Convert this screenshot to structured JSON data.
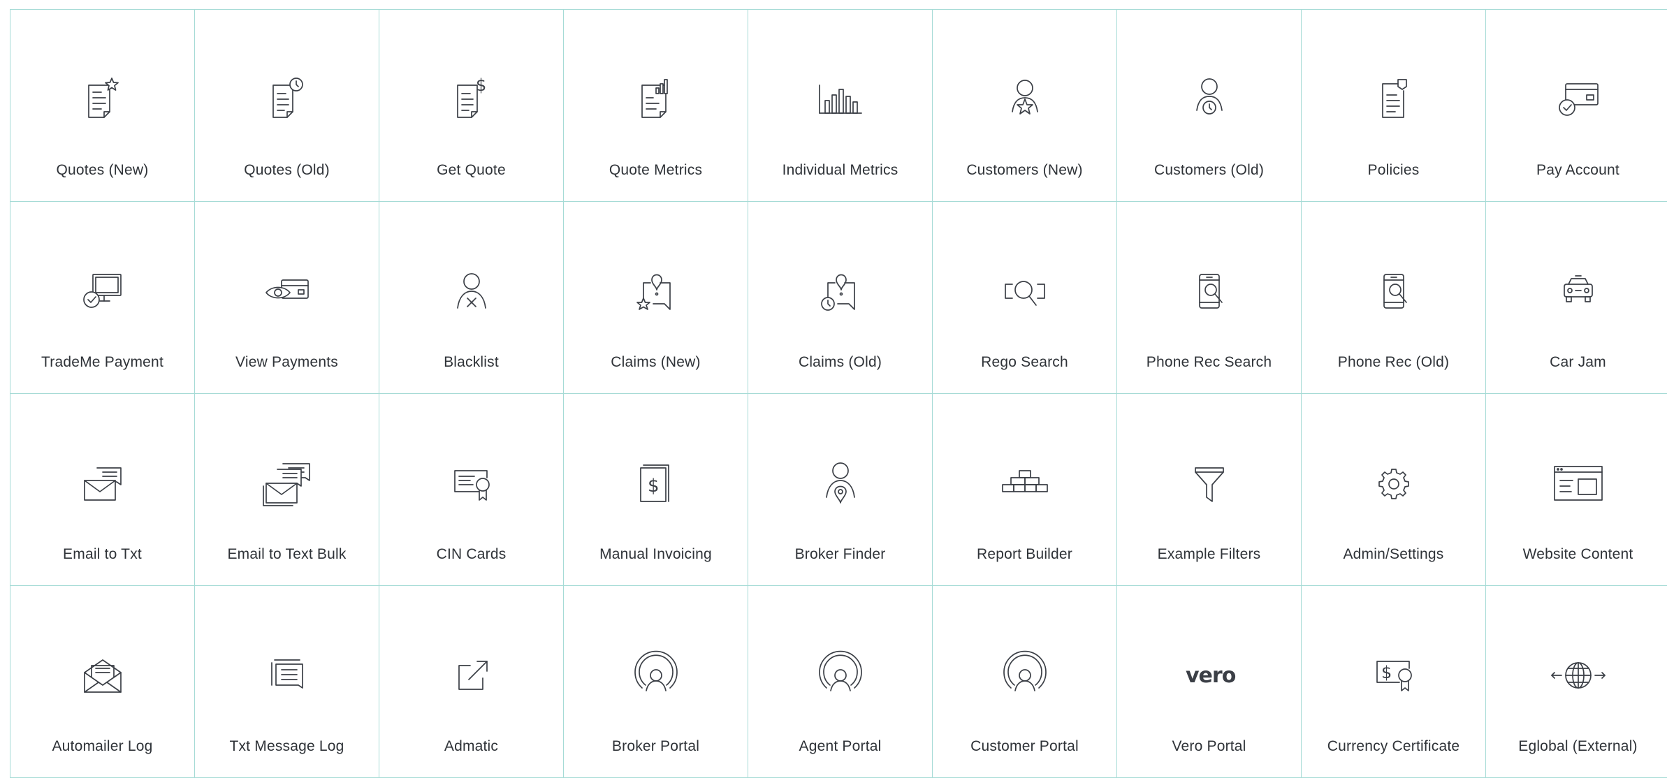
{
  "colors": {
    "grid_line": "#a6dbd6",
    "icon_stroke": "#3b3f46",
    "label_text": "#2f3338"
  },
  "tiles": [
    {
      "label": "Quotes (New)",
      "icon": "document-star-icon"
    },
    {
      "label": "Quotes (Old)",
      "icon": "document-clock-icon"
    },
    {
      "label": "Get Quote",
      "icon": "document-dollar-icon"
    },
    {
      "label": "Quote Metrics",
      "icon": "document-chart-icon"
    },
    {
      "label": "Individual Metrics",
      "icon": "bar-chart-icon"
    },
    {
      "label": "Customers (New)",
      "icon": "person-star-icon"
    },
    {
      "label": "Customers (Old)",
      "icon": "person-clock-icon"
    },
    {
      "label": "Policies",
      "icon": "clipboard-icon"
    },
    {
      "label": "Pay Account",
      "icon": "card-check-icon"
    },
    {
      "label": "TradeMe Payment",
      "icon": "monitor-check-icon"
    },
    {
      "label": "View Payments",
      "icon": "eye-card-icon"
    },
    {
      "label": "Blacklist",
      "icon": "person-x-icon"
    },
    {
      "label": "Claims (New)",
      "icon": "alert-chat-star-icon"
    },
    {
      "label": "Claims (Old)",
      "icon": "alert-chat-clock-icon"
    },
    {
      "label": "Rego Search",
      "icon": "plate-search-icon"
    },
    {
      "label": "Phone Rec Search",
      "icon": "phone-search-icon"
    },
    {
      "label": "Phone Rec (Old)",
      "icon": "phone-search-old-icon"
    },
    {
      "label": "Car Jam",
      "icon": "car-icon"
    },
    {
      "label": "Email to Txt",
      "icon": "envelope-chat-icon"
    },
    {
      "label": "Email to Text Bulk",
      "icon": "envelope-multi-chat-icon"
    },
    {
      "label": "CIN Cards",
      "icon": "certificate-card-icon"
    },
    {
      "label": "Manual Invoicing",
      "icon": "invoice-dollar-icon"
    },
    {
      "label": "Broker Finder",
      "icon": "person-pin-icon"
    },
    {
      "label": "Report Builder",
      "icon": "bricks-icon"
    },
    {
      "label": "Example Filters",
      "icon": "funnel-icon"
    },
    {
      "label": "Admin/Settings",
      "icon": "gear-icon"
    },
    {
      "label": "Website Content",
      "icon": "browser-window-icon"
    },
    {
      "label": "Automailer Log",
      "icon": "open-envelope-icon"
    },
    {
      "label": "Txt Message Log",
      "icon": "chat-lines-icon"
    },
    {
      "label": "Admatic",
      "icon": "external-link-icon"
    },
    {
      "label": "Broker Portal",
      "icon": "portal-person-icon"
    },
    {
      "label": "Agent Portal",
      "icon": "portal-person-icon"
    },
    {
      "label": "Customer Portal",
      "icon": "portal-person-icon"
    },
    {
      "label": "Vero Portal",
      "icon": "vero-logo-icon",
      "logo_text": "vero"
    },
    {
      "label": "Currency Certificate",
      "icon": "dollar-certificate-icon"
    },
    {
      "label": "Eglobal (External)",
      "icon": "globe-arrows-icon"
    }
  ]
}
